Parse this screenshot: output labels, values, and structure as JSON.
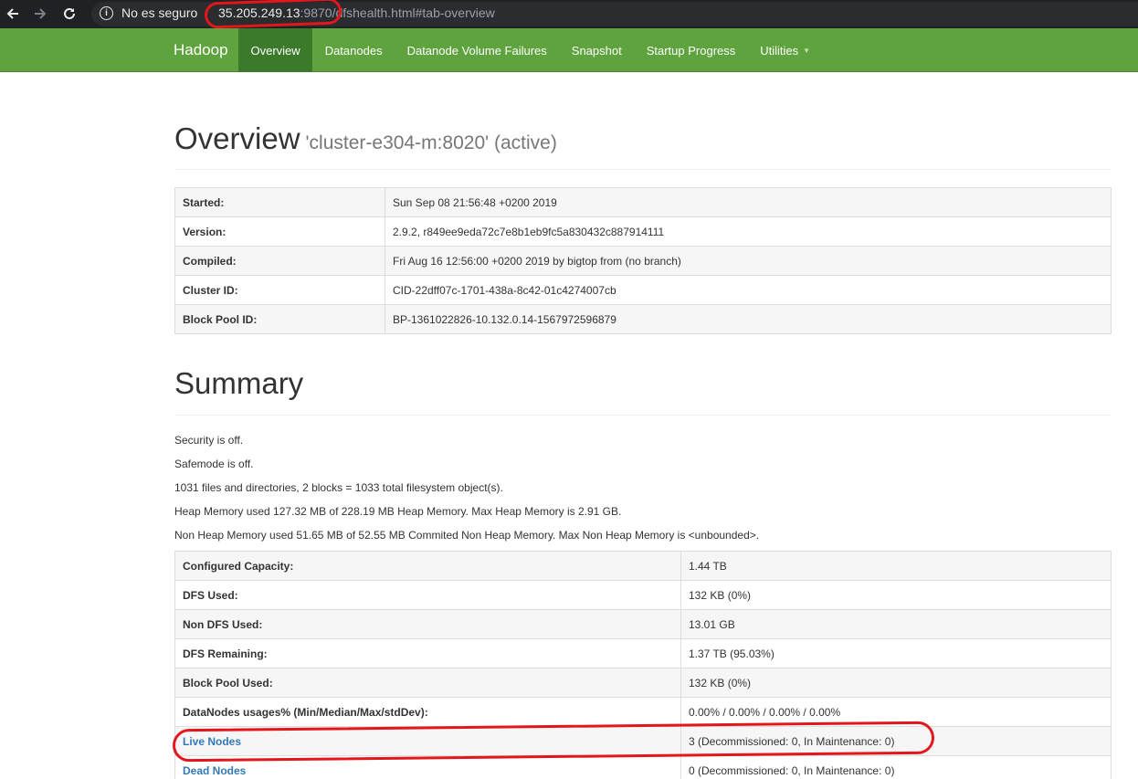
{
  "browser": {
    "insecure_label": "No es seguro",
    "url_host": "35.205.249.13",
    "url_rest": ":9870/dfshealth.html#tab-overview",
    "info_icon_glyph": "i",
    "back_icon": "arrow-left-icon",
    "forward_icon": "arrow-right-icon",
    "reload_icon": "reload-icon"
  },
  "navbar": {
    "brand": "Hadoop",
    "items": [
      {
        "label": "Overview",
        "active": true
      },
      {
        "label": "Datanodes"
      },
      {
        "label": "Datanode Volume Failures"
      },
      {
        "label": "Snapshot"
      },
      {
        "label": "Startup Progress"
      },
      {
        "label": "Utilities"
      }
    ],
    "caret": "▼"
  },
  "overview": {
    "title": "Overview",
    "subtitle": "'cluster-e304-m:8020' (active)",
    "rows": [
      {
        "label": "Started:",
        "value": "Sun Sep 08 21:56:48 +0200 2019"
      },
      {
        "label": "Version:",
        "value": "2.9.2, r849ee9eda72c7e8b1eb9fc5a830432c887914111"
      },
      {
        "label": "Compiled:",
        "value": "Fri Aug 16 12:56:00 +0200 2019 by bigtop from (no branch)"
      },
      {
        "label": "Cluster ID:",
        "value": "CID-22dff07c-1701-438a-8c42-01c4274007cb"
      },
      {
        "label": "Block Pool ID:",
        "value": "BP-1361022826-10.132.0.14-1567972596879"
      }
    ]
  },
  "summary": {
    "title": "Summary",
    "lines": [
      "Security is off.",
      "Safemode is off.",
      "1031 files and directories, 2 blocks = 1033 total filesystem object(s).",
      "Heap Memory used 127.32 MB of 228.19 MB Heap Memory. Max Heap Memory is 2.91 GB.",
      "Non Heap Memory used 51.65 MB of 52.55 MB Commited Non Heap Memory. Max Non Heap Memory is <unbounded>."
    ],
    "rows": [
      {
        "label": "Configured Capacity:",
        "value": "1.44 TB"
      },
      {
        "label": "DFS Used:",
        "value": "132 KB (0%)"
      },
      {
        "label": "Non DFS Used:",
        "value": "13.01 GB"
      },
      {
        "label": "DFS Remaining:",
        "value": "1.37 TB (95.03%)"
      },
      {
        "label": "Block Pool Used:",
        "value": "132 KB (0%)"
      },
      {
        "label": "DataNodes usages% (Min/Median/Max/stdDev):",
        "value": "0.00% / 0.00% / 0.00% / 0.00%"
      },
      {
        "label": "Live Nodes",
        "value": "3 (Decommissioned: 0, In Maintenance: 0)",
        "link": true
      },
      {
        "label": "Dead Nodes",
        "value": "0 (Decommissioned: 0, In Maintenance: 0)",
        "link": true
      }
    ]
  },
  "colors": {
    "navbar": "#5fa33e",
    "navbar_active": "#3b7a2a",
    "annotation": "#e2161b",
    "link": "#337ab7"
  }
}
